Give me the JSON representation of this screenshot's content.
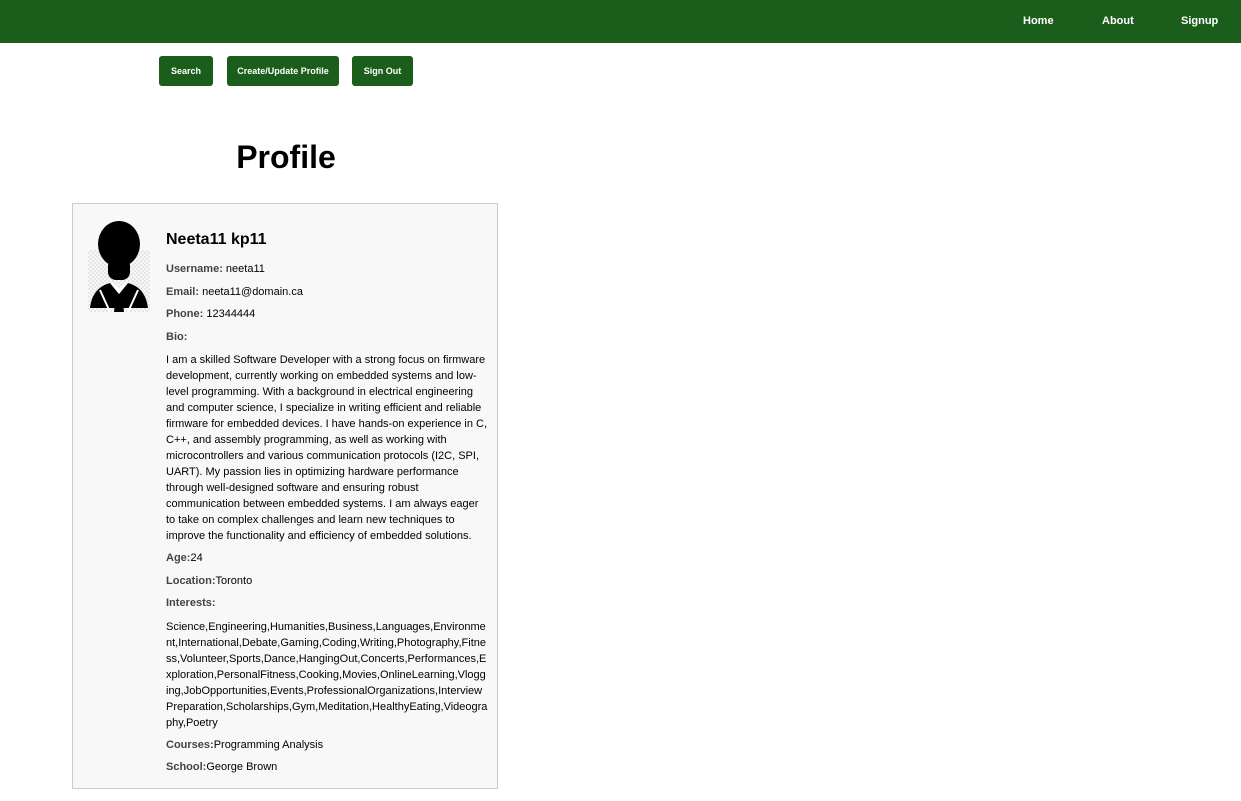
{
  "nav": {
    "home": "Home",
    "about": "About",
    "signup": "Signup"
  },
  "toolbar": {
    "search": "Search",
    "create_update": "Create/Update Profile",
    "sign_out": "Sign Out"
  },
  "page_title": "Profile",
  "profile": {
    "name": "Neeta11 kp11",
    "username_label": "Username:",
    "username": "neeta11",
    "email_label": "Email:",
    "email": "neeta11@domain.ca",
    "phone_label": "Phone:",
    "phone": "12344444",
    "bio_label": "Bio:",
    "bio": "I am a skilled Software Developer with a strong focus on firmware development, currently working on embedded systems and low-level programming. With a background in electrical engineering and computer science, I specialize in writing efficient and reliable firmware for embedded devices. I have hands-on experience in C, C++, and assembly programming, as well as working with microcontrollers and various communication protocols (I2C, SPI, UART). My passion lies in optimizing hardware performance through well-designed software and ensuring robust communication between embedded systems. I am always eager to take on complex challenges and learn new techniques to improve the functionality and efficiency of embedded solutions.",
    "age_label": "Age:",
    "age": "24",
    "location_label": "Location:",
    "location": "Toronto",
    "interests_label": "Interests:",
    "interests": "Science,Engineering,Humanities,Business,Languages,Environment,International,Debate,Gaming,Coding,Writing,Photography,Fitness,Volunteer,Sports,Dance,HangingOut,Concerts,Performances,Exploration,PersonalFitness,Cooking,Movies,OnlineLearning,Vlogging,JobOpportunities,Events,ProfessionalOrganizations,InterviewPreparation,Scholarships,Gym,Meditation,HealthyEating,Videography,Poetry",
    "courses_label": "Courses:",
    "courses": "Programming Analysis",
    "school_label": "School:",
    "school": "George Brown"
  },
  "colors": {
    "brand_green": "#1b5e1b",
    "card_bg": "#f8f8f8"
  }
}
